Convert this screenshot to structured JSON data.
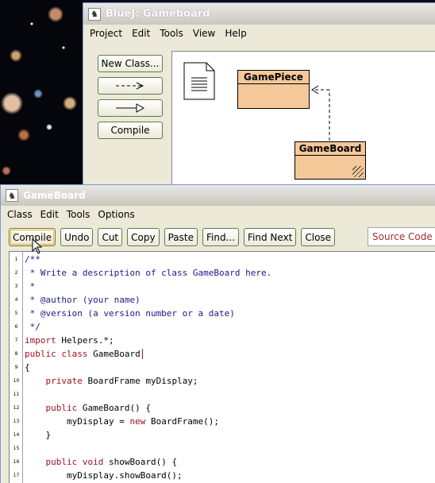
{
  "main_window": {
    "title": "BlueJ:  Gameboard",
    "menu": [
      "Project",
      "Edit",
      "Tools",
      "View",
      "Help"
    ],
    "tools": {
      "new_class": "New Class...",
      "compile": "Compile"
    },
    "classes": [
      {
        "name": "GamePiece"
      },
      {
        "name": "GameBoard"
      }
    ]
  },
  "editor": {
    "title": "GameBoard",
    "menu": [
      "Class",
      "Edit",
      "Tools",
      "Options"
    ],
    "toolbar": [
      "Compile",
      "Undo",
      "Cut",
      "Copy",
      "Paste",
      "Find...",
      "Find Next",
      "Close"
    ],
    "view_select": "Source Code",
    "lines": [
      {
        "n": "1",
        "text": "/**",
        "kind": "cm"
      },
      {
        "n": "2",
        "text": " * Write a description of class GameBoard here.",
        "kind": "cm"
      },
      {
        "n": "3",
        "text": " *",
        "kind": "cm"
      },
      {
        "n": "4",
        "text": " * @author (your name)",
        "kind": "cm"
      },
      {
        "n": "5",
        "text": " * @version (a version number or a date)",
        "kind": "cm"
      },
      {
        "n": "6",
        "text": " */",
        "kind": "cm"
      },
      {
        "n": "7",
        "text": "import Helpers.*;",
        "kind": "import"
      },
      {
        "n": "8",
        "text": "public class GameBoard",
        "kind": "class"
      },
      {
        "n": "9",
        "text": "{",
        "kind": "plain"
      },
      {
        "n": "10",
        "text": "    private BoardFrame myDisplay;",
        "kind": "private"
      },
      {
        "n": "11",
        "text": "",
        "kind": "plain"
      },
      {
        "n": "12",
        "text": "    public GameBoard() {",
        "kind": "public"
      },
      {
        "n": "13",
        "text": "        myDisplay = new BoardFrame();",
        "kind": "new"
      },
      {
        "n": "14",
        "text": "    }",
        "kind": "plain"
      },
      {
        "n": "15",
        "text": "",
        "kind": "plain"
      },
      {
        "n": "16",
        "text": "    public void showBoard() {",
        "kind": "publicvoid"
      },
      {
        "n": "17",
        "text": "        myDisplay.showBoard();",
        "kind": "plain"
      }
    ]
  }
}
